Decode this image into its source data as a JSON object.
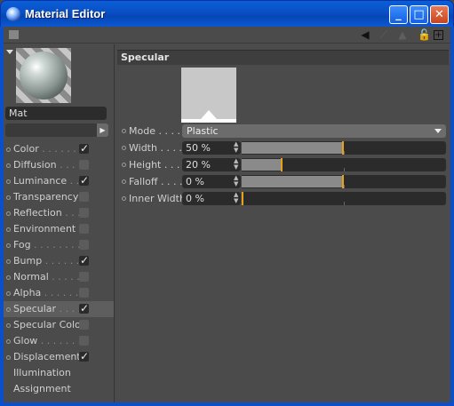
{
  "window": {
    "title": "Material Editor"
  },
  "material": {
    "name": "Mat"
  },
  "channels": [
    {
      "label": "Color",
      "dots": " . . . . . . . .",
      "checked": true,
      "active": false
    },
    {
      "label": "Diffusion",
      "dots": " . . . . .",
      "checked": false,
      "active": false
    },
    {
      "label": "Luminance",
      "dots": " . . .",
      "checked": true,
      "active": false
    },
    {
      "label": "Transparency",
      "dots": "",
      "checked": false,
      "active": false
    },
    {
      "label": "Reflection",
      "dots": " . . .",
      "checked": false,
      "active": false
    },
    {
      "label": "Environment",
      "dots": "",
      "checked": false,
      "active": false
    },
    {
      "label": "Fog",
      "dots": " . . . . . . . . .",
      "checked": false,
      "active": false
    },
    {
      "label": "Bump",
      "dots": " . . . . . . .",
      "checked": true,
      "active": false
    },
    {
      "label": "Normal",
      "dots": " . . . . . .",
      "checked": false,
      "active": false
    },
    {
      "label": "Alpha",
      "dots": " . . . . . . .",
      "checked": false,
      "active": false
    },
    {
      "label": "Specular",
      "dots": " . . . .",
      "checked": true,
      "active": true
    },
    {
      "label": "Specular Color",
      "dots": "",
      "checked": false,
      "active": false
    },
    {
      "label": "Glow",
      "dots": " . . . . . . . .",
      "checked": false,
      "active": false
    },
    {
      "label": "Displacement",
      "dots": "",
      "checked": true,
      "active": false
    },
    {
      "label": "Illumination",
      "dots": "",
      "checked": null,
      "active": false
    },
    {
      "label": "Assignment",
      "dots": "",
      "checked": null,
      "active": false
    }
  ],
  "specular": {
    "section_title": "Specular",
    "mode": {
      "label": "Mode . . . .",
      "value": "Plastic"
    },
    "params": [
      {
        "label": "Width . . . .",
        "value": "50 %",
        "fraction": 0.5
      },
      {
        "label": "Height . . . .",
        "value": "20 %",
        "fraction": 0.2
      },
      {
        "label": "Falloff . . . .",
        "value": "0 %",
        "fraction": 0.5
      },
      {
        "label": "Inner Width",
        "value": "0 %",
        "fraction": 0.0
      }
    ]
  },
  "colors": {
    "accent": "#e8a014",
    "titlebar": "#0a55d0"
  },
  "icons": [
    "grip-icon",
    "back-arrow-icon",
    "forward-arrow-icon",
    "up-arrow-icon",
    "lock-icon",
    "new-window-icon"
  ]
}
